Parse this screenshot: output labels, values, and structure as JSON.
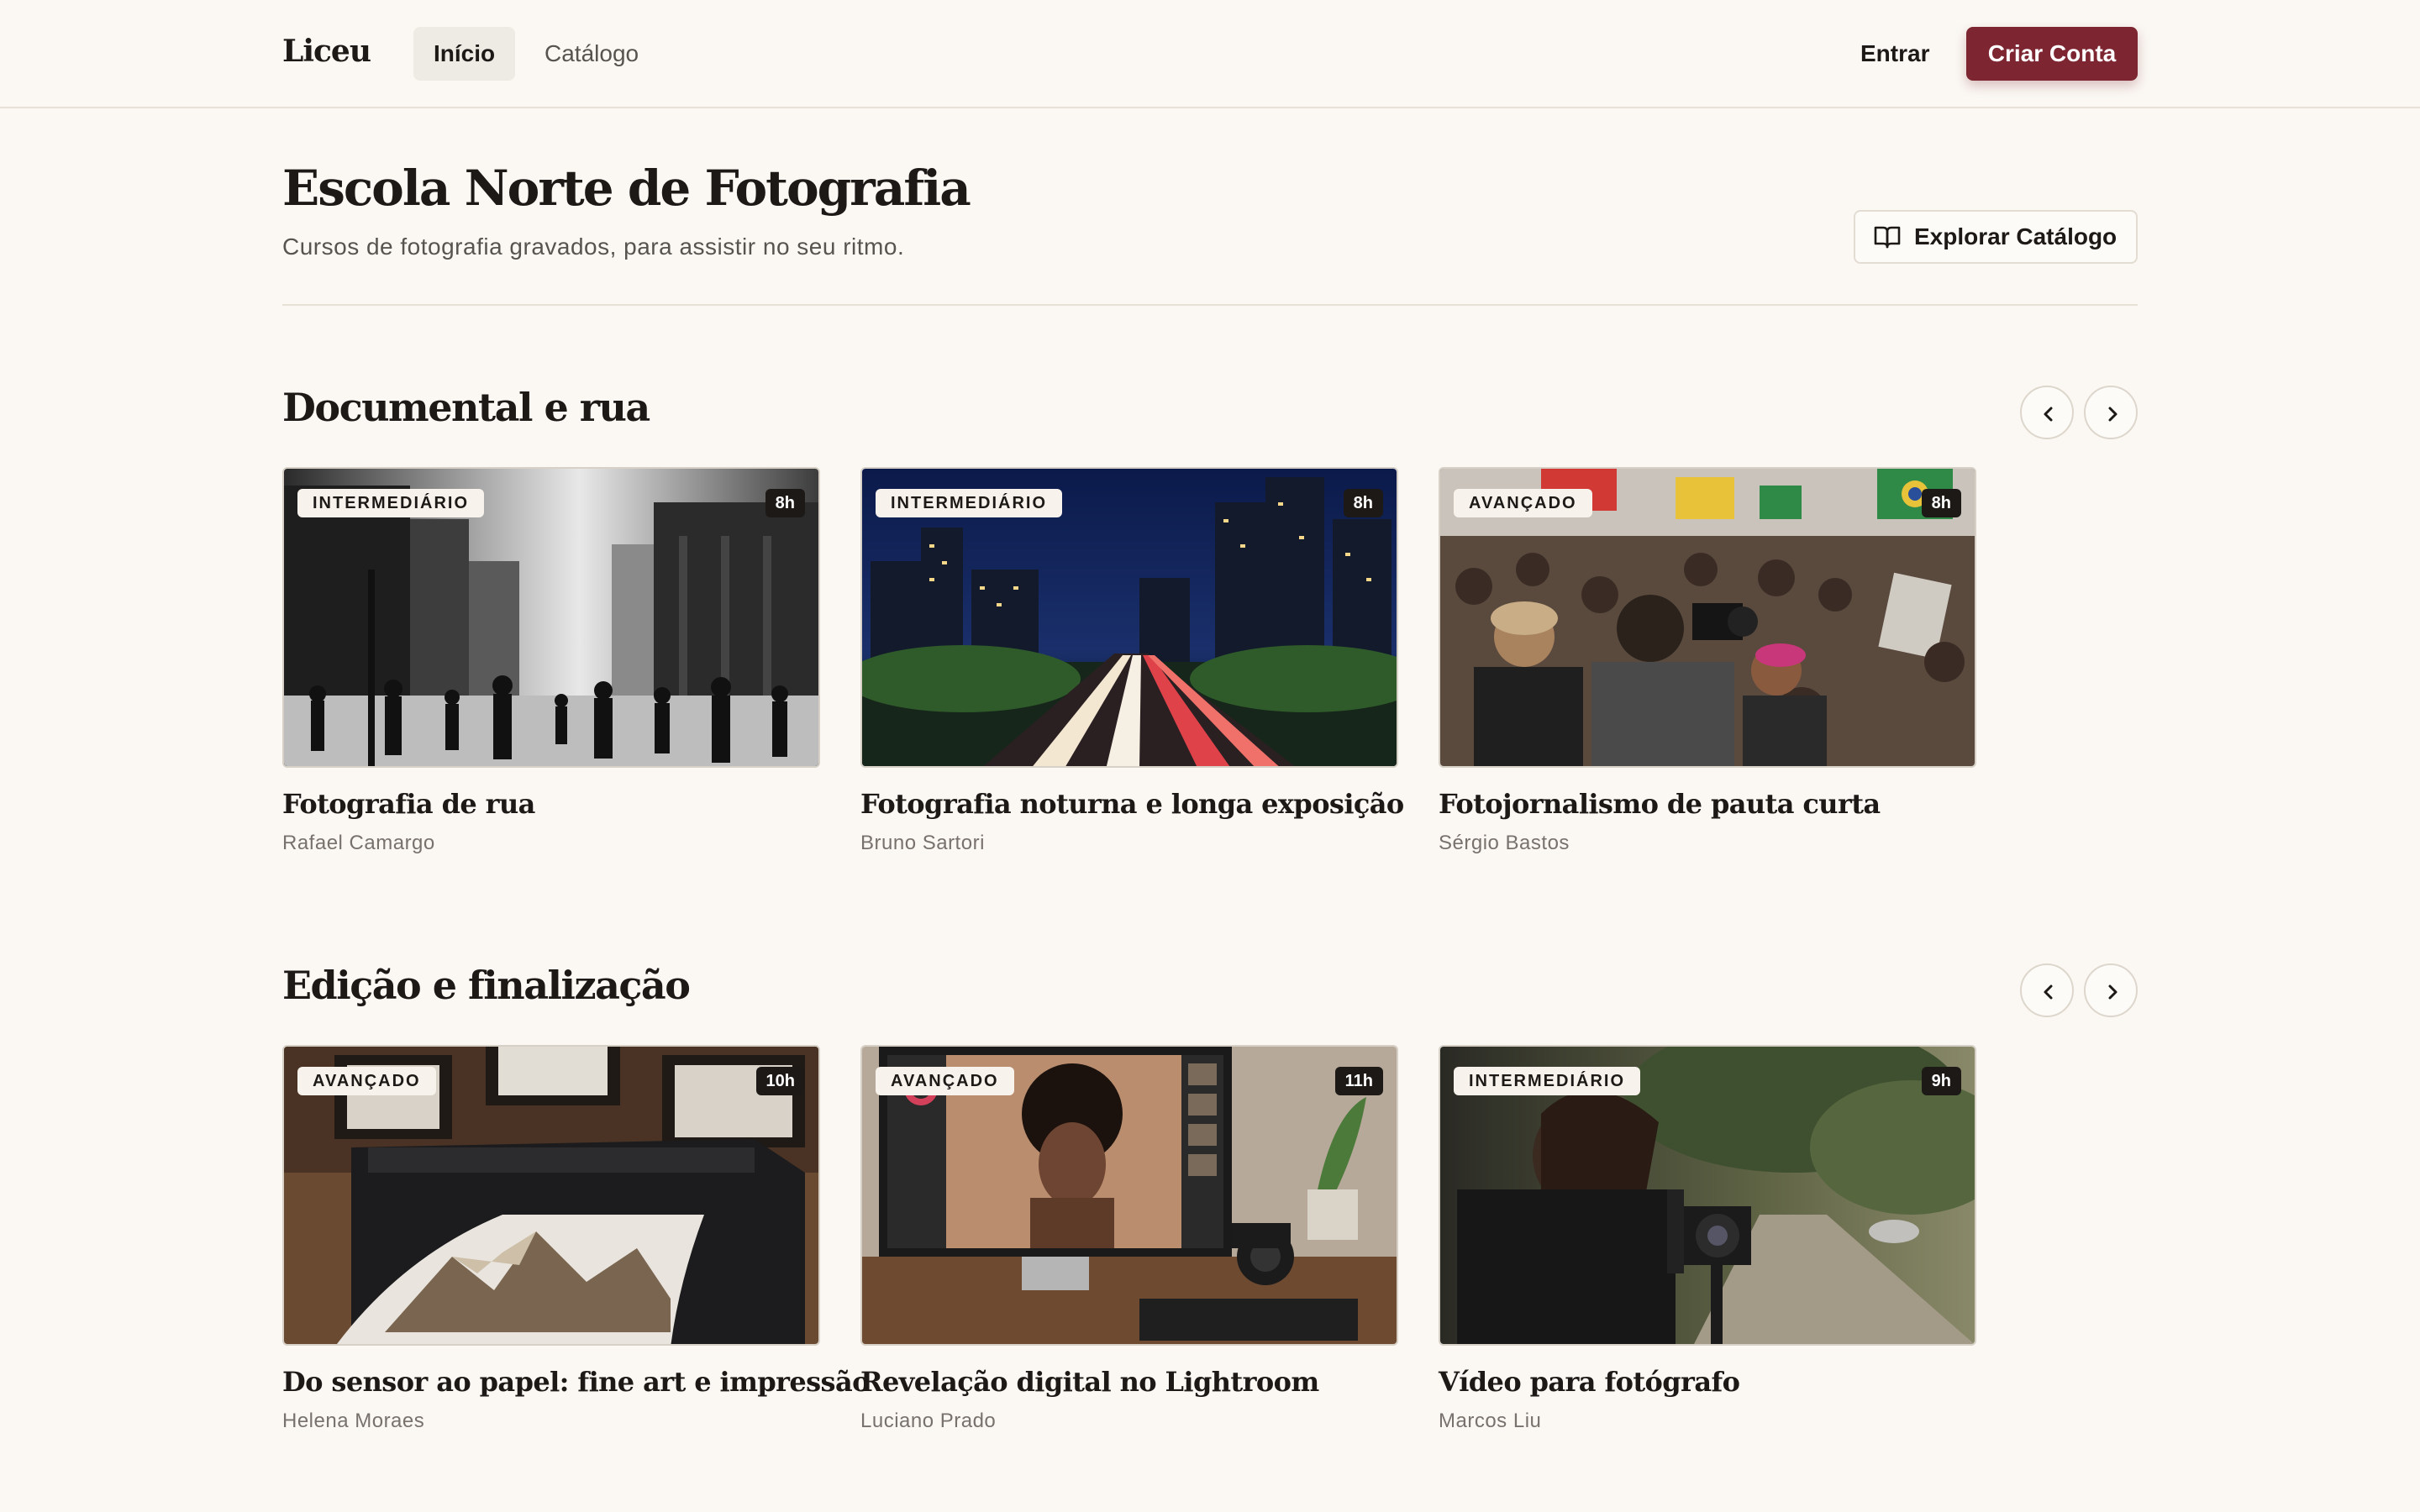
{
  "header": {
    "brand": "Liceu",
    "nav": [
      {
        "label": "Início",
        "active": true
      },
      {
        "label": "Catálogo",
        "active": false
      }
    ],
    "login_label": "Entrar",
    "signup_label": "Criar Conta"
  },
  "hero": {
    "title": "Escola Norte de Fotografia",
    "subtitle": "Cursos de fotografia gravados, para assistir no seu ritmo.",
    "explore_label": "Explorar Catálogo"
  },
  "sections": [
    {
      "title": "Documental e rua",
      "courses": [
        {
          "level": "INTERMEDIÁRIO",
          "duration": "8h",
          "title": "Fotografia de rua",
          "author": "Rafael Camargo"
        },
        {
          "level": "INTERMEDIÁRIO",
          "duration": "8h",
          "title": "Fotografia noturna e longa exposição",
          "author": "Bruno Sartori"
        },
        {
          "level": "AVANÇADO",
          "duration": "8h",
          "title": "Fotojornalismo de pauta curta",
          "author": "Sérgio Bastos"
        }
      ]
    },
    {
      "title": "Edição e finalização",
      "courses": [
        {
          "level": "AVANÇADO",
          "duration": "10h",
          "title": "Do sensor ao papel: fine art e impressão",
          "author": "Helena Moraes"
        },
        {
          "level": "AVANÇADO",
          "duration": "11h",
          "title": "Revelação digital no Lightroom",
          "author": "Luciano Prado"
        },
        {
          "level": "INTERMEDIÁRIO",
          "duration": "9h",
          "title": "Vídeo para fotógrafo",
          "author": "Marcos Liu"
        }
      ]
    }
  ],
  "colors": {
    "background": "#fbf8f3",
    "accent": "#7d2631",
    "text": "#1c1917",
    "muted": "#78716c"
  }
}
